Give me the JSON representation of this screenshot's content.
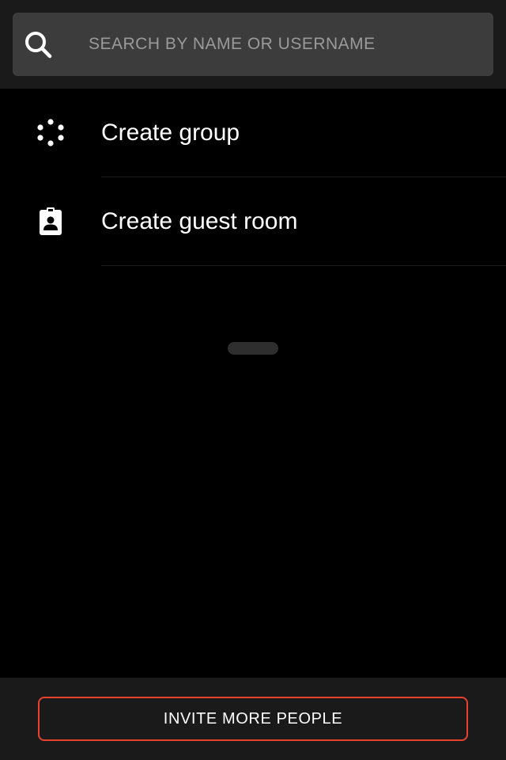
{
  "search": {
    "placeholder": "SEARCH BY NAME OR USERNAME",
    "value": "",
    "icon": "search-icon"
  },
  "actions": [
    {
      "label": "Create group",
      "icon": "group-dots-icon"
    },
    {
      "label": "Create guest room",
      "icon": "guest-badge-icon"
    }
  ],
  "footer": {
    "invite_label": "INVITE MORE PEOPLE"
  },
  "colors": {
    "background": "#000000",
    "bar": "#1a1a1a",
    "field": "#3c3c3c",
    "accent": "#e8412c",
    "text": "#ffffff",
    "placeholder": "#9a9a9a"
  }
}
